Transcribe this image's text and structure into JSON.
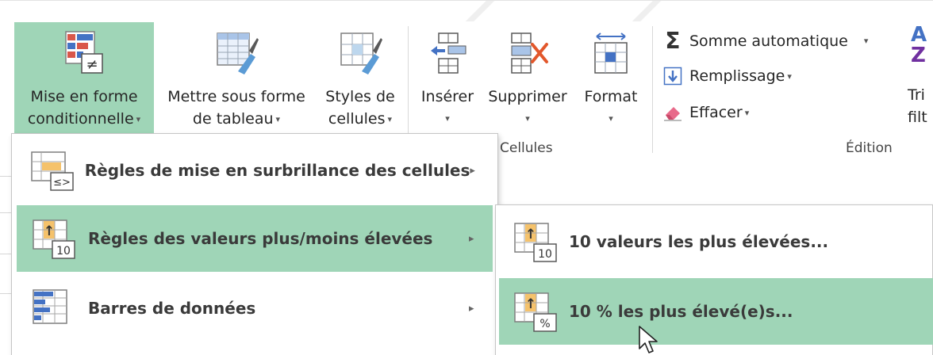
{
  "ribbon": {
    "buttons": {
      "conditional_format": {
        "line1": "Mise en forme",
        "line2": "conditionnelle"
      },
      "format_as_table": {
        "line1": "Mettre sous forme",
        "line2": "de tableau"
      },
      "cell_styles": {
        "line1": "Styles de",
        "line2": "cellules"
      },
      "insert": {
        "label": "Insérer"
      },
      "delete": {
        "label": "Supprimer"
      },
      "format": {
        "label": "Format"
      }
    },
    "groups": {
      "cells": "Cellules",
      "editing": "Édition"
    },
    "editing": {
      "autosum": "Somme automatique",
      "fill": "Remplissage",
      "clear": "Effacer",
      "sort_line1": "Tri",
      "sort_line2": "filt"
    },
    "sort_letters": {
      "a": "A",
      "z": "Z"
    },
    "accent_color": "#9fd5b7"
  },
  "menu": {
    "items": [
      {
        "label": "Règles de mise en surbrillance des cellules",
        "icon": "highlight-cells-rules-icon",
        "submenu": true
      },
      {
        "label": "Règles des valeurs plus/moins élevées",
        "icon": "top-bottom-rules-icon",
        "submenu": true,
        "active": true
      },
      {
        "label": "Barres de données",
        "icon": "data-bars-icon",
        "submenu": true
      }
    ]
  },
  "submenu": {
    "items": [
      {
        "label": "10 valeurs les plus élevées...",
        "badge": "10",
        "icon": "top-10-items-icon"
      },
      {
        "label": "10 % les plus élevé(e)s...",
        "badge": "%",
        "icon": "top-10-percent-icon",
        "active": true
      }
    ]
  },
  "icons": {
    "arrow_up": "↑",
    "ne_symbol": "≠",
    "cmp_symbol": "≤>",
    "sigma": "Σ",
    "submenu_arrow": "▸",
    "dropdown_caret": "▾"
  }
}
